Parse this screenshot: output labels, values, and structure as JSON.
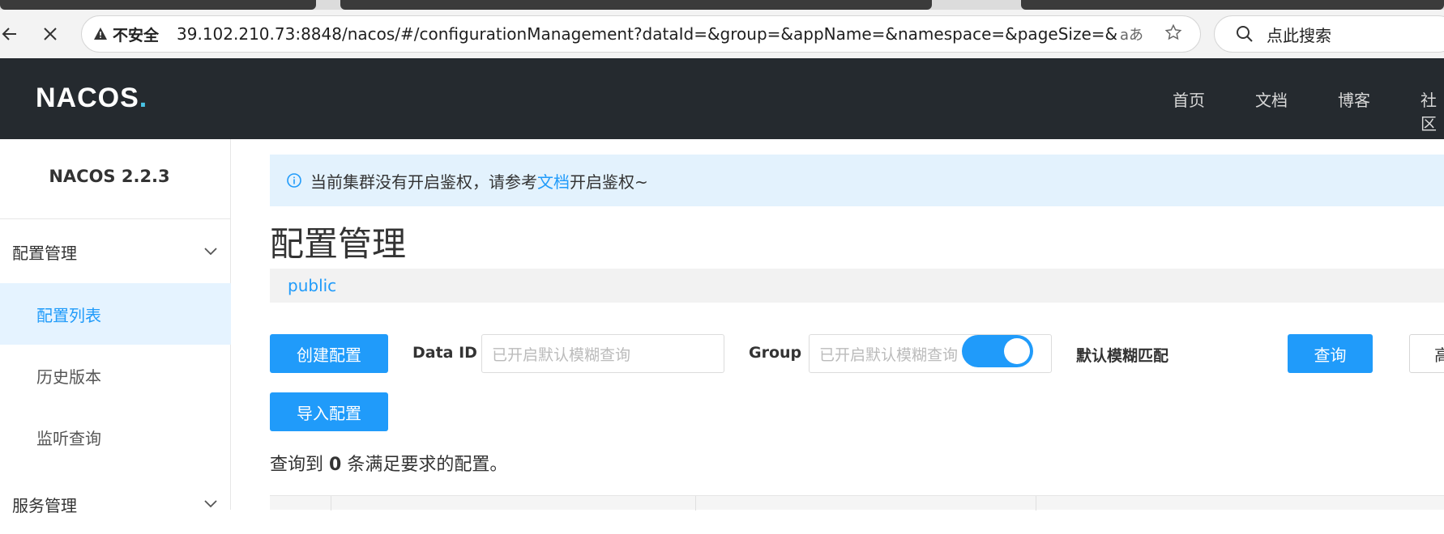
{
  "browser": {
    "security_label": "不安全",
    "url": "39.102.210.73:8848/nacos/#/configurationManagement?dataId=&group=&appName=&namespace=&pageSize=&pageNo=",
    "read_aloud": "aあ",
    "search_placeholder": "点此搜索"
  },
  "topnav": {
    "logo_main": "NACOS",
    "logo_dot": ".",
    "items": [
      "首页",
      "文档",
      "博客",
      "社区"
    ]
  },
  "sidebar": {
    "version": "NACOS 2.2.3",
    "group1": "配置管理",
    "items": [
      "配置列表",
      "历史版本",
      "监听查询"
    ],
    "group2": "服务管理"
  },
  "main": {
    "alert_prefix": "当前集群没有开启鉴权，请参考",
    "alert_link": "文档",
    "alert_suffix": "开启鉴权~",
    "title": "配置管理",
    "namespace": "public",
    "create_button": "创建配置",
    "import_button": "导入配置",
    "dataid_label": "Data ID",
    "dataid_placeholder": "已开启默认模糊查询",
    "group_label": "Group",
    "group_placeholder": "已开启默认模糊查询",
    "fuzzy_label": "默认模糊匹配",
    "fuzzy_on": true,
    "query_button": "查询",
    "advanced_button": "高",
    "result_prefix": "查询到",
    "result_count": "0",
    "result_suffix": "条满足要求的配置。"
  },
  "colors": {
    "accent": "#209bfa",
    "topnav_bg": "#252a2f",
    "active_bg": "#e5f3ff"
  }
}
